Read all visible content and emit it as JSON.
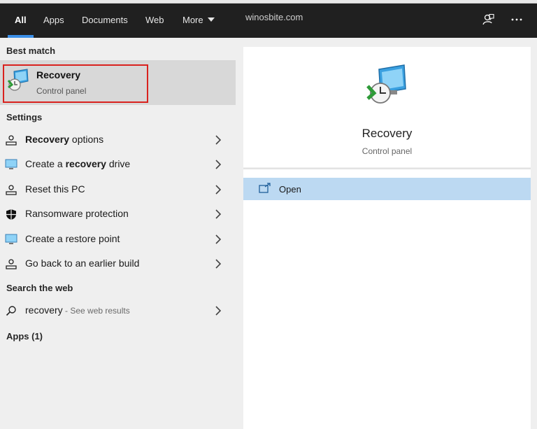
{
  "header": {
    "tabs": [
      {
        "label": "All",
        "active": true
      },
      {
        "label": "Apps"
      },
      {
        "label": "Documents"
      },
      {
        "label": "Web"
      },
      {
        "label": "More"
      }
    ],
    "site": "winosbite.com",
    "icons": [
      "feedback-icon",
      "more-options-icon"
    ]
  },
  "left": {
    "best_match_heading": "Best match",
    "best_match": {
      "title": "Recovery",
      "subtitle": "Control panel",
      "icon": "recovery-icon"
    },
    "settings_heading": "Settings",
    "settings": [
      {
        "pre": "",
        "bold": "Recovery",
        "post": " options",
        "icon": "person-sync-icon"
      },
      {
        "pre": "Create a ",
        "bold": "recovery",
        "post": " drive",
        "icon": "monitor-icon"
      },
      {
        "pre": "Reset this PC",
        "bold": "",
        "post": "",
        "icon": "person-sync-icon"
      },
      {
        "pre": "Ransomware protection",
        "bold": "",
        "post": "",
        "icon": "shield-icon"
      },
      {
        "pre": "Create a restore point",
        "bold": "",
        "post": "",
        "icon": "monitor-icon"
      },
      {
        "pre": "Go back to an earlier build",
        "bold": "",
        "post": "",
        "icon": "person-sync-icon"
      }
    ],
    "web_heading": "Search the web",
    "web": {
      "query": "recovery",
      "suffix": " - See web results",
      "icon": "search-icon"
    },
    "apps_heading": "Apps (1)"
  },
  "right": {
    "title": "Recovery",
    "subtitle": "Control panel",
    "open_label": "Open",
    "icon": "recovery-icon"
  },
  "colors": {
    "header_bg": "#202020",
    "accent": "#3b8fe8",
    "highlight_outline": "#d9221e",
    "selected_bg": "#d8d8d8",
    "open_row_bg": "#bcd9f2"
  }
}
